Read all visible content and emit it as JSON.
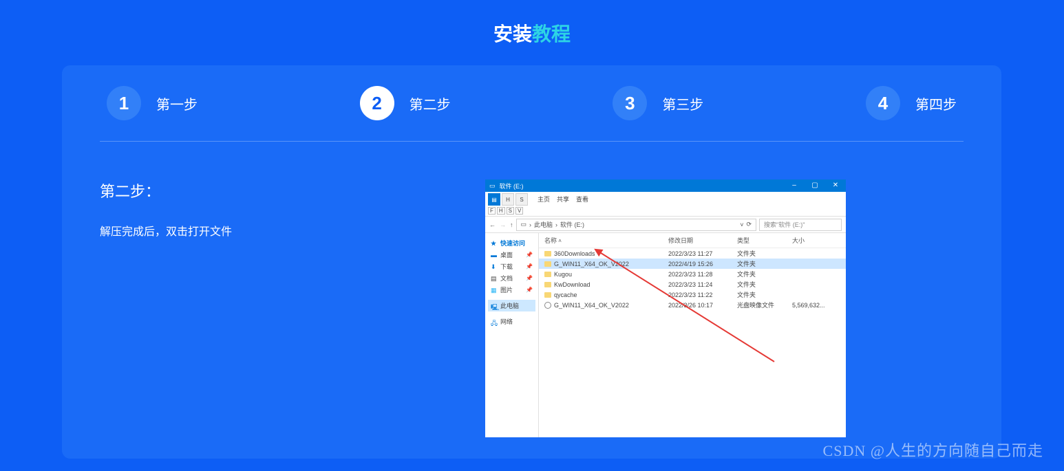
{
  "title": {
    "part1": "安装",
    "part2": "教程"
  },
  "steps": [
    {
      "num": "1",
      "label": "第一步"
    },
    {
      "num": "2",
      "label": "第二步"
    },
    {
      "num": "3",
      "label": "第三步"
    },
    {
      "num": "4",
      "label": "第四步"
    }
  ],
  "active_step": 1,
  "content": {
    "heading": "第二步：",
    "desc": "解压完成后，双击打开文件"
  },
  "explorer": {
    "title": "软件 (E:)",
    "ribbon_tabs": [
      "主页",
      "共享",
      "查看"
    ],
    "ribbon_keys": [
      "F",
      "H",
      "S",
      "V"
    ],
    "path_root": "此电脑",
    "path_current": "软件 (E:)",
    "search_placeholder": "搜索\"软件 (E:)\"",
    "win_buttons": {
      "min": "–",
      "max": "▢",
      "close": "✕"
    },
    "sidebar": [
      {
        "label": "快速访问",
        "type": "header"
      },
      {
        "label": "桌面",
        "pinned": true
      },
      {
        "label": "下载",
        "pinned": true
      },
      {
        "label": "文档",
        "pinned": true
      },
      {
        "label": "图片",
        "pinned": true
      },
      {
        "label": "此电脑",
        "type": "selected"
      },
      {
        "label": "网络",
        "type": "item"
      }
    ],
    "columns": [
      "名称",
      "修改日期",
      "类型",
      "大小"
    ],
    "rows": [
      {
        "name": "360Downloads",
        "date": "2022/3/23 11:27",
        "type": "文件夹",
        "size": "",
        "icon": "folder"
      },
      {
        "name": "G_WIN11_X64_OK_V2022",
        "date": "2022/4/19 15:26",
        "type": "文件夹",
        "size": "",
        "icon": "folder",
        "selected": true
      },
      {
        "name": "Kugou",
        "date": "2022/3/23 11:28",
        "type": "文件夹",
        "size": "",
        "icon": "folder"
      },
      {
        "name": "KwDownload",
        "date": "2022/3/23 11:24",
        "type": "文件夹",
        "size": "",
        "icon": "folder"
      },
      {
        "name": "qycache",
        "date": "2022/3/23 11:22",
        "type": "文件夹",
        "size": "",
        "icon": "folder"
      },
      {
        "name": "G_WIN11_X64_OK_V2022",
        "date": "2022/3/26 10:17",
        "type": "光盘映像文件",
        "size": "5,569,632...",
        "icon": "iso"
      }
    ]
  },
  "watermark": "CSDN @人生的方向随自己而走"
}
